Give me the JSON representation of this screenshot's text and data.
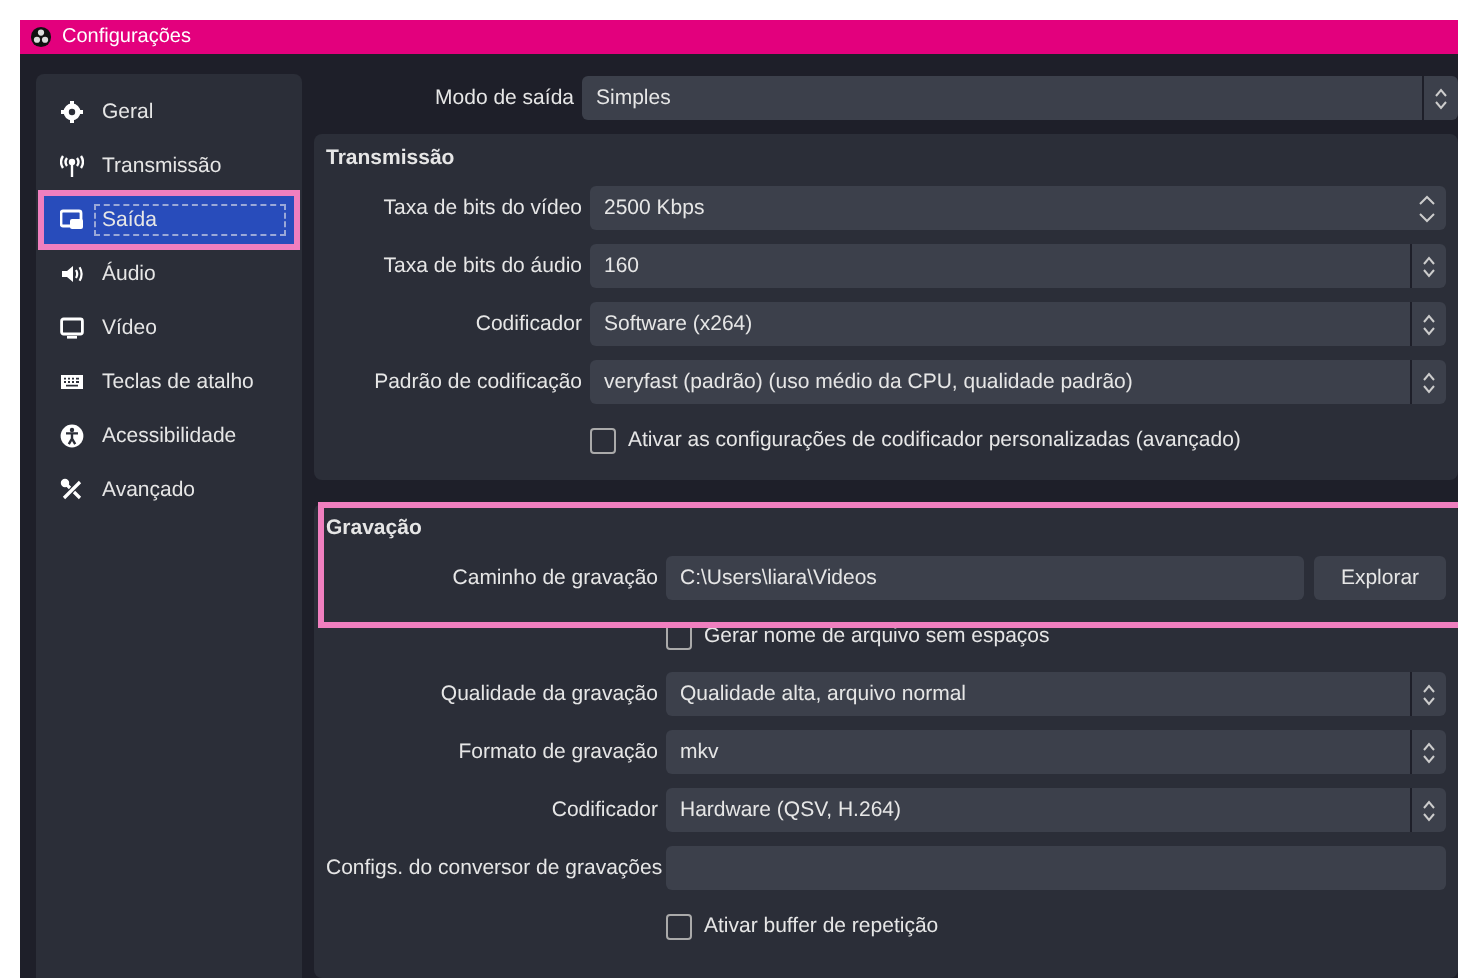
{
  "window": {
    "title": "Configurações"
  },
  "sidebar": {
    "items": [
      {
        "label": "Geral",
        "selected": false,
        "highlighted": false
      },
      {
        "label": "Transmissão",
        "selected": false,
        "highlighted": false
      },
      {
        "label": "Saída",
        "selected": true,
        "highlighted": true
      },
      {
        "label": "Áudio",
        "selected": false,
        "highlighted": false
      },
      {
        "label": "Vídeo",
        "selected": false,
        "highlighted": false
      },
      {
        "label": "Teclas de atalho",
        "selected": false,
        "highlighted": false
      },
      {
        "label": "Acessibilidade",
        "selected": false,
        "highlighted": false
      },
      {
        "label": "Avançado",
        "selected": false,
        "highlighted": false
      }
    ]
  },
  "output_mode": {
    "label": "Modo de saída",
    "value": "Simples"
  },
  "groups": [
    {
      "title": "Transmissão",
      "highlighted": false,
      "rows": [
        {
          "kind": "spin",
          "label": "Taxa de bits do vídeo",
          "value": "2500 Kbps"
        },
        {
          "kind": "select",
          "label": "Taxa de bits do áudio",
          "value": "160"
        },
        {
          "kind": "select",
          "label": "Codificador",
          "value": "Software (x264)"
        },
        {
          "kind": "select",
          "label": "Padrão de codificação",
          "value": "veryfast (padrão) (uso médio da CPU, qualidade padrão)"
        },
        {
          "kind": "checkbox",
          "label": "Ativar as configurações de codificador personalizadas (avançado)",
          "checked": false
        }
      ]
    },
    {
      "title": "Gravação",
      "highlighted": true,
      "rows": [
        {
          "kind": "path",
          "label": "Caminho de gravação",
          "value": "C:\\Users\\liara\\Videos",
          "button": "Explorar"
        },
        {
          "kind": "checkbox",
          "label": "Gerar nome de arquivo sem espaços",
          "checked": false
        },
        {
          "kind": "select",
          "label": "Qualidade da gravação",
          "value": "Qualidade alta, arquivo normal"
        },
        {
          "kind": "select",
          "label": "Formato de gravação",
          "value": "mkv"
        },
        {
          "kind": "select",
          "label": "Codificador",
          "value": "Hardware (QSV, H.264)"
        },
        {
          "kind": "text",
          "label": "Configs. do conversor de gravações"
        },
        {
          "kind": "checkbox",
          "label": "Ativar buffer de repetição",
          "checked": false
        }
      ]
    }
  ]
}
